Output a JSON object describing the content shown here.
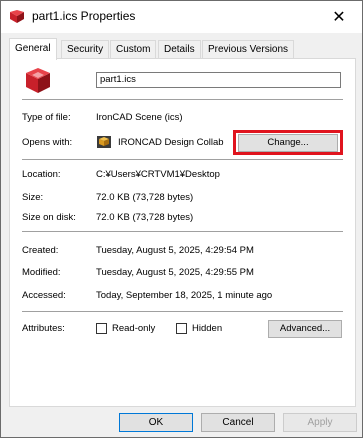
{
  "window": {
    "title": "part1.ics Properties",
    "close_glyph": "✕"
  },
  "tabs": [
    {
      "label": "General",
      "active": true
    },
    {
      "label": "Security"
    },
    {
      "label": "Custom"
    },
    {
      "label": "Details"
    },
    {
      "label": "Previous Versions"
    }
  ],
  "general": {
    "file_name": "part1.ics",
    "type_label": "Type of file:",
    "type_value": "IronCAD Scene (ics)",
    "opens_label": "Opens with:",
    "opens_value": "IRONCAD Design Collab",
    "change_button": "Change...",
    "location_label": "Location:",
    "location_value": "C:¥Users¥CRTVM1¥Desktop",
    "size_label": "Size:",
    "size_value": "72.0 KB (73,728 bytes)",
    "size_on_disk_label": "Size on disk:",
    "size_on_disk_value": "72.0 KB (73,728 bytes)",
    "created_label": "Created:",
    "created_value": "Tuesday, August 5, 2025, 4:29:54 PM",
    "modified_label": "Modified:",
    "modified_value": "Tuesday, August 5, 2025, 4:29:55 PM",
    "accessed_label": "Accessed:",
    "accessed_value": "Today, September 18, 2025, 1 minute ago",
    "attributes_label": "Attributes:",
    "readonly_label": "Read-only",
    "hidden_label": "Hidden",
    "advanced_button": "Advanced..."
  },
  "buttons": {
    "ok": "OK",
    "cancel": "Cancel",
    "apply": "Apply"
  },
  "colors": {
    "highlight": "#e0141e",
    "accent": "#0078d7",
    "brand_red": "#d0282e"
  }
}
